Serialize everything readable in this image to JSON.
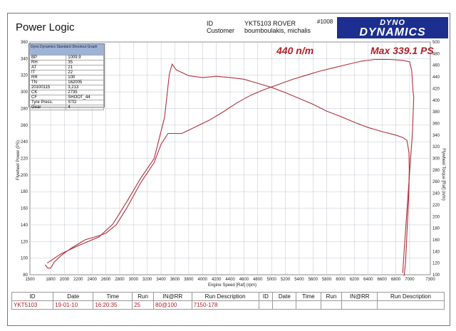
{
  "header": {
    "title": "Power Logic",
    "id_label": "ID",
    "customer_label": "Customer",
    "id_value": "YKT5103 ROVER",
    "customer_value": "boumboulakis, michalis",
    "ref": "#1008",
    "logo_line1": "DYNO",
    "logo_line2": "DYNAMICS"
  },
  "annotations": {
    "torque": "440 n/m",
    "power": "Max 339.1 PS"
  },
  "info_box": {
    "title": "Dyno Dynamics Standard Shootout Graph",
    "rows": [
      [
        "BP",
        "1009.9"
      ],
      [
        "RH",
        "35"
      ],
      [
        "AT",
        "21"
      ],
      [
        "IT",
        "22"
      ],
      [
        "RR",
        "100"
      ],
      [
        "TN",
        "162005"
      ],
      [
        "20100115",
        "3,213"
      ],
      [
        "CK",
        "2735"
      ],
      [
        "CF",
        "SHOOT_44"
      ],
      [
        "Tyre Press.",
        "STD"
      ],
      [
        "Gear",
        "4"
      ]
    ]
  },
  "chart_data": {
    "type": "line",
    "xlabel": "Engine Speed [Raf] (rpm)",
    "ylabel_left": "Flywheel Power (PS)",
    "ylabel_right": "Flywheel Torque [Raf] (n/m)",
    "xlim": [
      1500,
      7300
    ],
    "ylim_left": [
      80,
      360
    ],
    "ylim_right": [
      100,
      500
    ],
    "x_ticks": [
      1500,
      1800,
      2000,
      2200,
      2400,
      2600,
      2800,
      3000,
      3200,
      3400,
      3600,
      3800,
      4000,
      4200,
      4400,
      4600,
      4800,
      5000,
      5200,
      5400,
      5600,
      5800,
      6000,
      6200,
      6400,
      6600,
      6800,
      7000,
      7300
    ],
    "y_left_ticks": [
      80,
      100,
      120,
      140,
      160,
      180,
      200,
      220,
      240,
      260,
      280,
      300,
      320,
      340,
      360
    ],
    "y_right_ticks": [
      100,
      120,
      140,
      160,
      180,
      200,
      220,
      240,
      260,
      280,
      300,
      320,
      340,
      360,
      380,
      400,
      420,
      440,
      460,
      480,
      500
    ],
    "grid": true,
    "series": [
      {
        "axis": "left",
        "values": [
          [
            1720,
            92
          ],
          [
            1760,
            88
          ],
          [
            1800,
            88
          ],
          [
            1850,
            95
          ],
          [
            1950,
            103
          ],
          [
            2100,
            112
          ],
          [
            2300,
            122
          ],
          [
            2500,
            127
          ],
          [
            2600,
            130
          ],
          [
            2750,
            140
          ],
          [
            2900,
            160
          ],
          [
            3100,
            190
          ],
          [
            3300,
            215
          ],
          [
            3400,
            237
          ],
          [
            3500,
            250
          ],
          [
            3550,
            250
          ],
          [
            3700,
            250
          ],
          [
            3900,
            258
          ],
          [
            4100,
            266
          ],
          [
            4300,
            276
          ],
          [
            4500,
            287
          ],
          [
            4700,
            296
          ],
          [
            4900,
            303
          ],
          [
            5100,
            309
          ],
          [
            5300,
            315
          ],
          [
            5500,
            320
          ],
          [
            5700,
            325
          ],
          [
            5900,
            329
          ],
          [
            6100,
            333
          ],
          [
            6300,
            337
          ],
          [
            6500,
            339
          ],
          [
            6700,
            339
          ],
          [
            6900,
            338
          ],
          [
            7000,
            336
          ],
          [
            7030,
            326
          ],
          [
            7040,
            312
          ],
          [
            7050,
            300
          ],
          [
            7060,
            294
          ],
          [
            7040,
            250
          ],
          [
            6980,
            180
          ],
          [
            6930,
            120
          ],
          [
            6900,
            82
          ]
        ]
      },
      {
        "axis": "right",
        "values": [
          [
            1750,
            120
          ],
          [
            1950,
            136
          ],
          [
            2200,
            150
          ],
          [
            2500,
            165
          ],
          [
            2700,
            187
          ],
          [
            2900,
            225
          ],
          [
            3100,
            265
          ],
          [
            3300,
            300
          ],
          [
            3450,
            370
          ],
          [
            3520,
            445
          ],
          [
            3560,
            462
          ],
          [
            3620,
            452
          ],
          [
            3800,
            442
          ],
          [
            4000,
            439
          ],
          [
            4200,
            441
          ],
          [
            4400,
            439
          ],
          [
            4600,
            436
          ],
          [
            4800,
            429
          ],
          [
            5000,
            422
          ],
          [
            5200,
            413
          ],
          [
            5400,
            403
          ],
          [
            5600,
            393
          ],
          [
            5800,
            381
          ],
          [
            6000,
            372
          ],
          [
            6200,
            362
          ],
          [
            6400,
            353
          ],
          [
            6600,
            346
          ],
          [
            6800,
            340
          ],
          [
            6900,
            336
          ],
          [
            6960,
            331
          ],
          [
            6990,
            310
          ],
          [
            6995,
            280
          ],
          [
            6985,
            230
          ],
          [
            6960,
            170
          ],
          [
            6940,
            120
          ],
          [
            6920,
            98
          ]
        ]
      }
    ],
    "colors": {
      "curve": "#b0303a",
      "grid": "#bfc4cc",
      "annotation": "#b0202a"
    }
  },
  "run_table": {
    "headers": [
      "ID",
      "Date",
      "Time",
      "Run",
      "IN@RR",
      "Run Description",
      "ID",
      "Date",
      "Time",
      "Run",
      "IN@RR",
      "Run Description"
    ],
    "row": [
      "YKT5103",
      "19-01-10",
      "16:20:35",
      "25",
      "80@100",
      "7150-178",
      "",
      "",
      "",
      "",
      "",
      ""
    ]
  }
}
